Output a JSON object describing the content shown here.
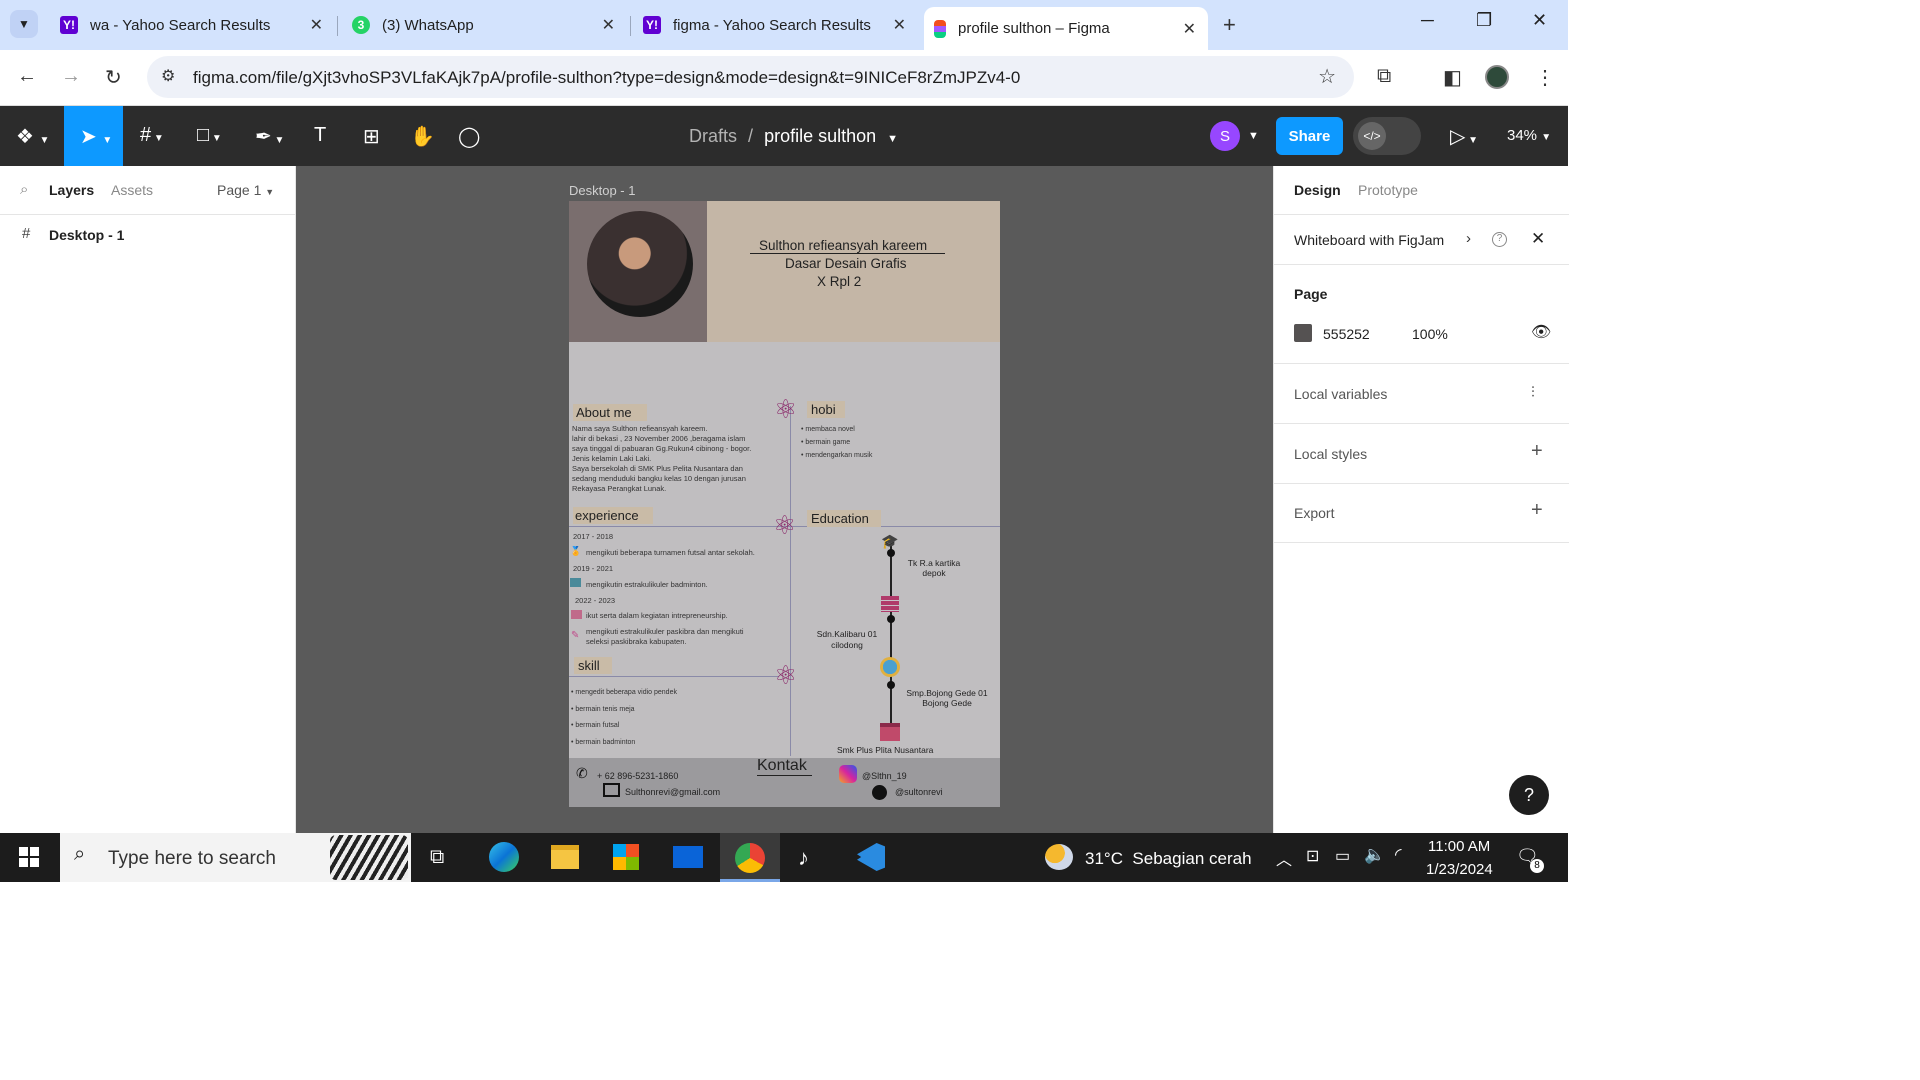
{
  "browser": {
    "tabs": [
      {
        "title": "wa - Yahoo Search Results",
        "icon": "yahoo-icon"
      },
      {
        "title": "(3) WhatsApp",
        "icon": "whatsapp-icon",
        "badge": "3"
      },
      {
        "title": "figma - Yahoo Search Results",
        "icon": "yahoo-icon"
      },
      {
        "title": "profile sulthon – Figma",
        "icon": "figma-icon",
        "active": true
      }
    ],
    "url": "figma.com/file/gXjt3vhoSP3VLfaKAjk7pA/profile-sulthon?type=design&mode=design&t=9INICeF8rZmJPZv4-0"
  },
  "toolbar": {
    "breadcrumb_parent": "Drafts",
    "breadcrumb_sep": "/",
    "file_name": "profile sulthon",
    "avatar_letter": "S",
    "share_label": "Share",
    "zoom": "34%"
  },
  "left_panel": {
    "tabs": [
      "Layers",
      "Assets"
    ],
    "page_selector": "Page 1",
    "layers": [
      "Desktop - 1"
    ]
  },
  "canvas": {
    "frame_label": "Desktop - 1",
    "design": {
      "name": "Sulthon refieansyah kareem",
      "subject": "Dasar Desain Grafis",
      "class": "X Rpl 2",
      "about_title": "About me",
      "about_lines": [
        "Nama saya Sulthon refieansyah kareem.",
        "lahir di bekasi , 23 November 2006 ,beragama islam",
        "saya tinggal di pabuaran Gg.Rukun4 cibinong - bogor.",
        "Jenis kelamin Laki Laki.",
        "Saya bersekolah di SMK Plus Pelita Nusantara dan",
        "sedang menduduki bangku kelas 10 dengan jurusan",
        "Rekayasa Perangkat Lunak."
      ],
      "hobi_title": "hobi",
      "hobi_items": [
        "• membaca novel",
        "• bermain game",
        "• mendengarkan musik"
      ],
      "experience_title": "experience",
      "experience": [
        {
          "year": "2017 - 2018",
          "text": "mengikuti beberapa turnamen futsal antar sekolah."
        },
        {
          "year": "2019 - 2021",
          "text": "mengikutin estrakulikuler badminton."
        },
        {
          "year": "2022 - 2023",
          "text": "ikut serta dalam kegiatan intrepreneurship."
        },
        {
          "year": "",
          "text": "mengikuti estrakulikuler paskibra dan mengikuti seleksi paskibraka kabupaten."
        }
      ],
      "education_title": "Education",
      "education": [
        "Tk R.a kartika depok",
        "Sdn.Kalibaru 01 cilodong",
        "Smp.Bojong Gede 01 Bojong Gede",
        "Smk Plus Plita Nusantara"
      ],
      "skill_title": "skill",
      "skills": [
        "• mengedit beberapa vidio pendek",
        "• bermain tenis meja",
        "• bermain futsal",
        "• bermain badminton"
      ],
      "kontak_title": "Kontak",
      "phone": "+ 62 896-5231-1860",
      "email": "Sulthonrevi@gmail.com",
      "instagram": "@Slthn_19",
      "tiktok": "@sultonrevi"
    }
  },
  "right_panel": {
    "tabs": [
      "Design",
      "Prototype"
    ],
    "whiteboard": "Whiteboard with FigJam",
    "page_title": "Page",
    "page_color": "555252",
    "page_opacity": "100%",
    "local_variables": "Local variables",
    "local_styles": "Local styles",
    "export": "Export",
    "help": "?"
  },
  "taskbar": {
    "search_placeholder": "Type here to search",
    "weather": "31°C  Sebagian cerah",
    "time": "11:00 AM",
    "date": "1/23/2024",
    "notif_count": "8"
  },
  "colors": {
    "figma_blue": "#0d99ff",
    "toolbar_bg": "#2c2c2c",
    "canvas_bg": "#5a5a5a",
    "tab_strip": "#d3e3fd"
  }
}
